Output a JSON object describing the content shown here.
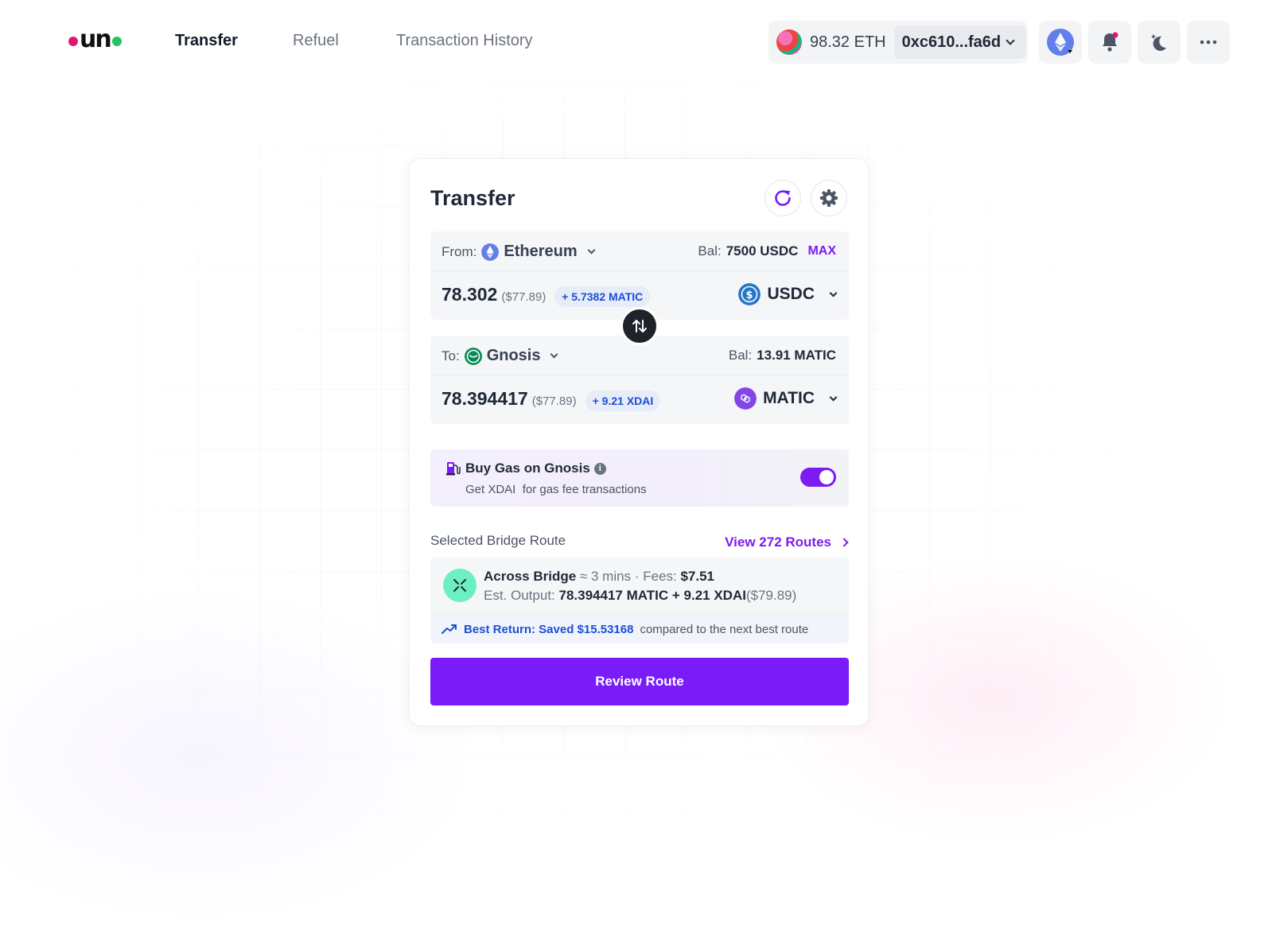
{
  "header": {
    "logo_text": "un",
    "nav": [
      {
        "label": "Transfer",
        "active": true
      },
      {
        "label": "Refuel",
        "active": false
      },
      {
        "label": "Transaction History",
        "active": false
      }
    ],
    "wallet_balance": "98.32 ETH",
    "wallet_address": "0xc610...fa6d",
    "icons": [
      "ethereum-icon",
      "bell-icon",
      "moon-icon",
      "more-icon"
    ]
  },
  "card": {
    "title": "Transfer",
    "from": {
      "label": "From:",
      "chain": "Ethereum",
      "bal_label": "Bal:",
      "bal_value": "7500 USDC",
      "max_label": "MAX",
      "amount": "78.302",
      "amount_usd": "($77.89)",
      "extra": "+ 5.7382 MATIC",
      "token": "USDC"
    },
    "to": {
      "label": "To:",
      "chain": "Gnosis",
      "bal_label": "Bal:",
      "bal_value": "13.91 MATIC",
      "amount": "78.394417",
      "amount_usd": "($77.89)",
      "extra": "+ 9.21 XDAI",
      "token": "MATIC"
    },
    "gas": {
      "title": "Buy Gas on Gnosis",
      "subtitle": "Get XDAI  for gas fee transactions",
      "enabled": true
    },
    "route": {
      "label": "Selected Bridge Route",
      "view_routes": "View 272 Routes",
      "bridge_name": "Across Bridge",
      "time": "≈ 3 mins",
      "separator": "·",
      "fees_label": "Fees:",
      "fees_value": "$7.51",
      "output_label": "Est. Output:",
      "output_value": "78.394417 MATIC + 9.21 XDAI",
      "output_usd": "($79.89)",
      "best_label": "Best Return: Saved $15.53168",
      "best_rest": "compared to the next best route"
    },
    "cta": "Review Route"
  },
  "colors": {
    "accent": "#7a1cf7",
    "blue_text": "#1d4ed8",
    "bridge_green": "#6cf0c2"
  }
}
